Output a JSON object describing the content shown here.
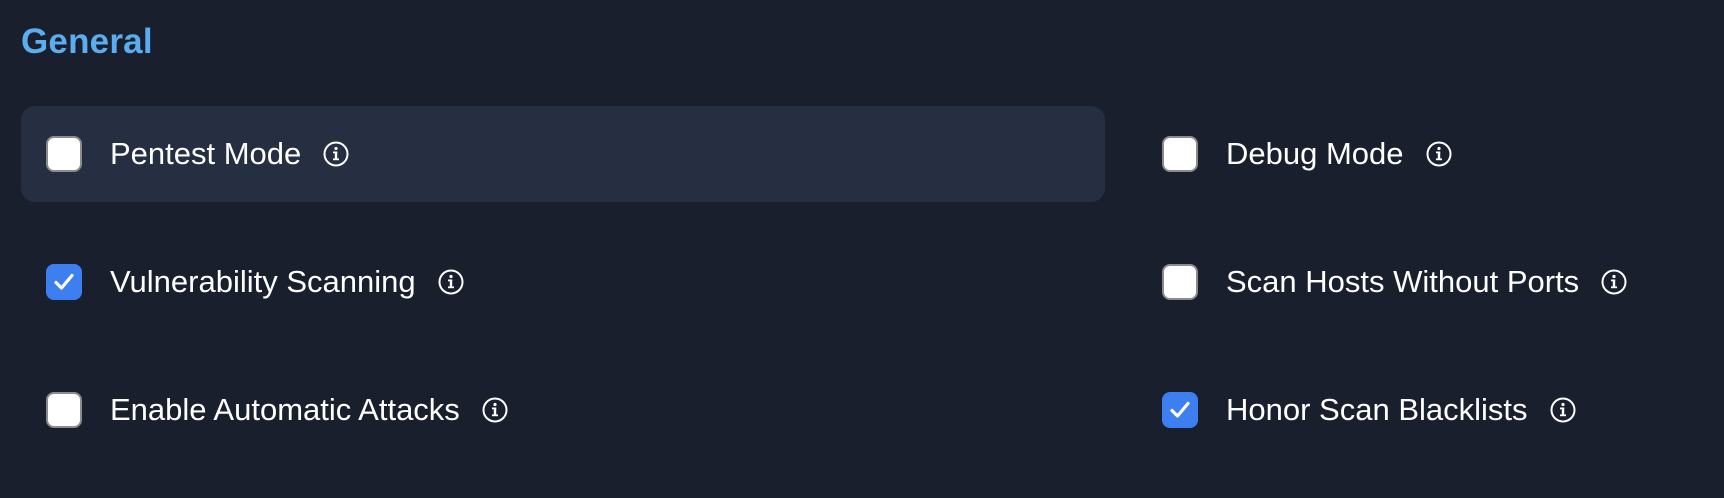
{
  "section": {
    "title": "General"
  },
  "options": {
    "pentest_mode": {
      "label": "Pentest Mode",
      "checked": false
    },
    "vulnerability_scanning": {
      "label": "Vulnerability Scanning",
      "checked": true
    },
    "enable_automatic_attacks": {
      "label": "Enable Automatic Attacks",
      "checked": false
    },
    "debug_mode": {
      "label": "Debug Mode",
      "checked": false
    },
    "scan_hosts_without_ports": {
      "label": "Scan Hosts Without Ports",
      "checked": false
    },
    "honor_scan_blacklists": {
      "label": "Honor Scan Blacklists",
      "checked": true
    }
  },
  "icons": {
    "info": "info-circle-icon",
    "check": "checkmark-icon"
  },
  "colors": {
    "background": "#1a1f2e",
    "title": "#5aaef0",
    "highlight_row": "#262f42",
    "checkbox_checked": "#3d7ef0",
    "text": "#ffffff"
  }
}
